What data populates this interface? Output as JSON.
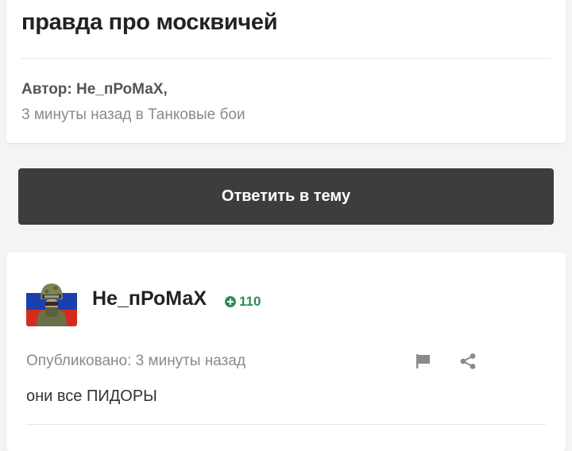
{
  "topic": {
    "title": "правда про москвичей",
    "author_line": "Автор: Не_пРоМаХ,",
    "meta_line": "3 минуты назад в Танковые бои"
  },
  "reply_button": {
    "label": "Ответить в тему"
  },
  "post": {
    "username": "Не_пРоМаХ",
    "reputation": "110",
    "posted": "Опубликовано: 3 минуты назад",
    "content": "они все ПИДОРЫ"
  },
  "colors": {
    "reputation_green": "#2e8b57",
    "button_dark": "#3d3d3d"
  },
  "icons": [
    "plus-circle-icon",
    "flag-icon",
    "share-icon"
  ]
}
